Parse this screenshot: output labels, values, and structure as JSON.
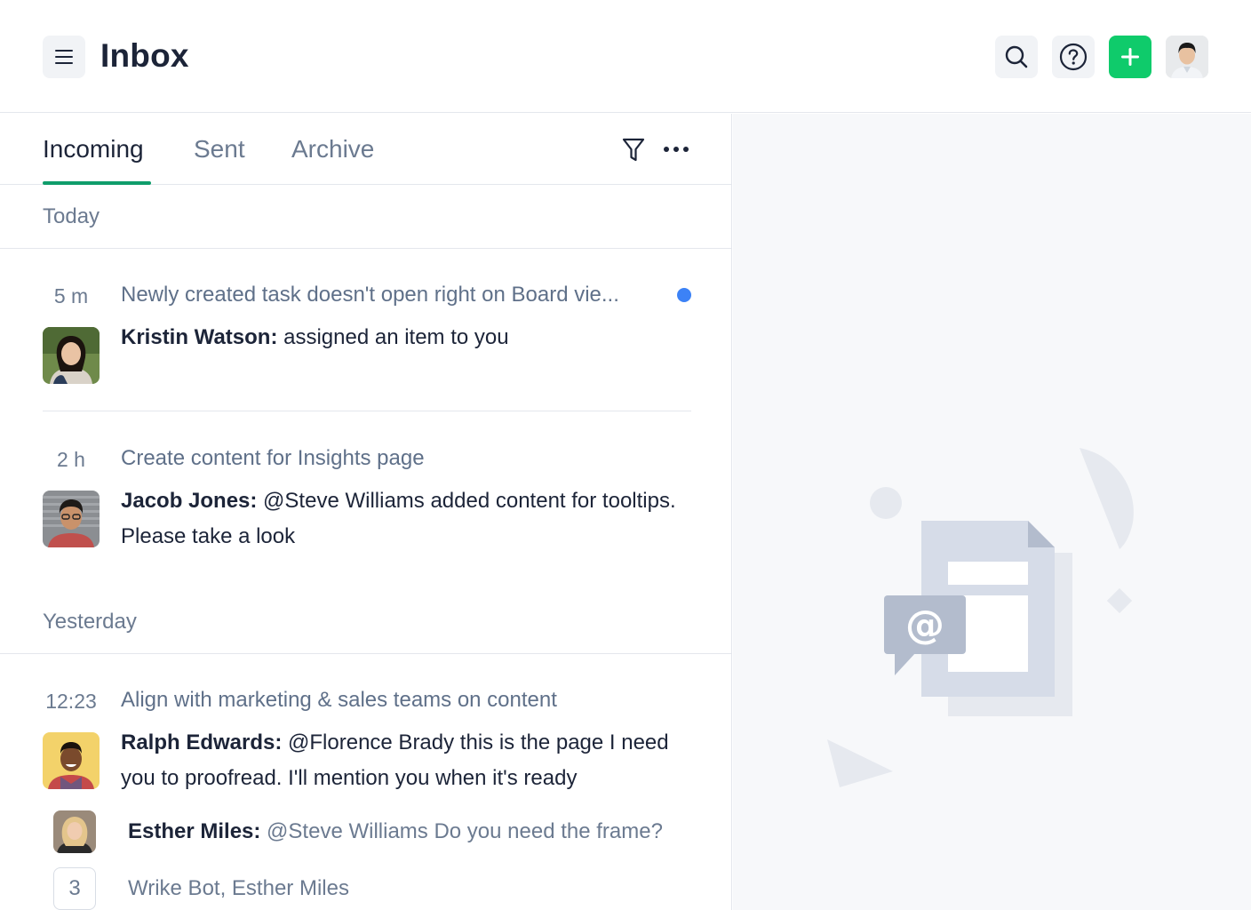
{
  "header": {
    "title": "Inbox",
    "icons": {
      "menu": "menu-icon",
      "search": "search-icon",
      "help": "help-icon",
      "add": "plus-icon"
    }
  },
  "tabs": [
    {
      "label": "Incoming",
      "active": true
    },
    {
      "label": "Sent",
      "active": false
    },
    {
      "label": "Archive",
      "active": false
    }
  ],
  "sections": {
    "today": "Today",
    "yesterday": "Yesterday"
  },
  "items": [
    {
      "time": "5 m",
      "subject": "Newly created task doesn't open right on Board vie...",
      "unread": true,
      "author": "Kristin Watson:",
      "message": " assigned an item to you"
    },
    {
      "time": "2 h",
      "subject": "Create content for Insights page",
      "unread": false,
      "author": "Jacob Jones:",
      "message": " @Steve Williams added content for tooltips. Please take a look"
    },
    {
      "time": "12:23",
      "subject": "Align with marketing & sales teams on content",
      "unread": false,
      "author": "Ralph Edwards:",
      "message": " @Florence Brady this is the page I need you to proofread. I'll mention you when it's ready",
      "reply": {
        "author": "Esther Miles:",
        "text": " @Steve Williams Do you need the frame?"
      },
      "more": {
        "count": "3",
        "names": "Wrike Bot, Esther Miles"
      }
    }
  ],
  "colors": {
    "accent": "#0f9d6b",
    "add_button": "#0fcb6b",
    "unread_dot": "#3c82f6"
  }
}
